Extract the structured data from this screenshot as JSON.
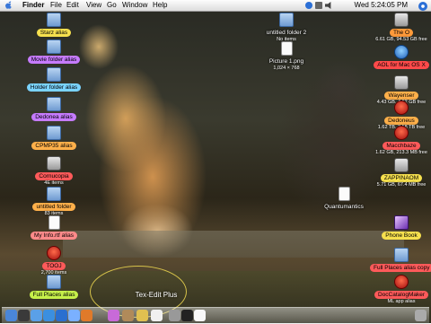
{
  "menubar": {
    "items": [
      "Finder",
      "File",
      "Edit",
      "View",
      "Go",
      "Window",
      "Help"
    ],
    "clock": "Wed 5:24:05 PM"
  },
  "desktop_icons_left": [
    {
      "label": "Starz alias",
      "icon": "folder-icon",
      "color": "#f6e04e"
    },
    {
      "label": "Movie folder alias",
      "icon": "folder-icon",
      "color": "#c67bff"
    },
    {
      "label": "Holder folder alias",
      "icon": "folder-icon",
      "color": "#7ad3ff"
    },
    {
      "label": "Dedonea alias",
      "icon": "folder-icon",
      "color": "#c67bff"
    },
    {
      "label": "CPMP35 alias",
      "icon": "folder-icon",
      "color": "#ffb04a"
    },
    {
      "label": "Cornucopia",
      "icon": "disk-icon",
      "color": "#ff5a5a",
      "sub": "4E items"
    },
    {
      "label": "untitled folder",
      "icon": "folder-icon",
      "color": "#ffb04a",
      "sub": "83 items"
    },
    {
      "label": "My Info.rtf alias",
      "icon": "document-icon",
      "color": "#ff8a8a"
    },
    {
      "label": "TOOJ",
      "icon": "red-disk-icon",
      "color": "#ff5a5a",
      "sub": "2,700 items"
    },
    {
      "label": "Full Places alias",
      "icon": "folder-icon",
      "color": "#c6f04a"
    }
  ],
  "desktop_icons_middle": [
    {
      "label": "untitled folder 2",
      "sub": "No items",
      "icon": "folder-icon"
    },
    {
      "label": "Picture 1.png",
      "sub": "1,024 × 768",
      "icon": "document-icon"
    },
    {
      "label": "Quantumantics",
      "icon": "document-icon"
    }
  ],
  "desktop_icons_right": [
    {
      "label": "The O",
      "sub": "6.61 GB, 94.53 GB free",
      "icon": "disk-icon",
      "color": "#ff9a3a"
    },
    {
      "label": "AOL for Mac OS X",
      "icon": "blue-icon",
      "color": "#ff4a4a"
    },
    {
      "label": "Wayenser",
      "sub": "4.43 GB, 4.62 GB free",
      "icon": "disk-icon",
      "color": "#ffb04a"
    },
    {
      "label": "Dedoneus",
      "sub": "1.62 TB, 3.58 TB free",
      "icon": "red-disk-icon",
      "color": "#ffb04a"
    },
    {
      "label": "Macchbaze",
      "sub": "1.62 GB, 213.3 MB free",
      "icon": "red-disk-icon",
      "color": "#ff5a5a"
    },
    {
      "label": "ZAPPINAOM",
      "sub": "5.71 GB, 67.4 MB free",
      "icon": "disk-icon",
      "color": "#f6e04e"
    },
    {
      "label": "Phone Book",
      "icon": "app-icon",
      "color": "#f6e04e"
    },
    {
      "label": "Full Places alias copy",
      "icon": "folder-icon",
      "color": "#ff5a5a"
    },
    {
      "label": "DocCatalogMaker",
      "sub": "ML app alias",
      "icon": "red-disk-icon",
      "color": "#ff5a5a"
    }
  ],
  "dock": {
    "hover_label": "Tex-Edit Plus",
    "apps": [
      "finder-icon",
      "dashboard-icon",
      "mail-icon",
      "safari-icon",
      "ichat-icon",
      "itunes-icon",
      "iphoto-icon",
      "preview-icon",
      "address-book-icon",
      "texedit-icon",
      "calendar-icon",
      "system-preferences-icon",
      "terminal-icon",
      "textedit-icon",
      "trash-icon"
    ]
  }
}
